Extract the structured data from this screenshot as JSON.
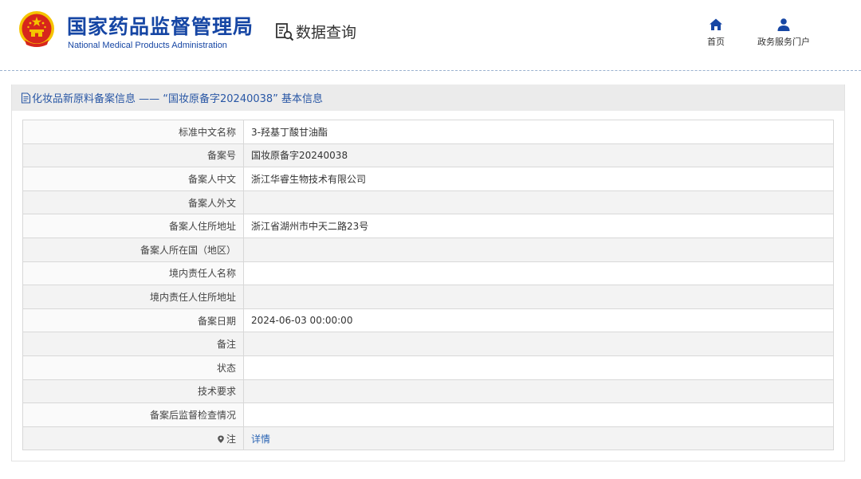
{
  "header": {
    "title_cn": "国家药品监督管理局",
    "title_en": "National Medical Products Administration",
    "query_label": "数据查询",
    "nav": {
      "home": "首页",
      "portal": "政务服务门户"
    }
  },
  "panel": {
    "title": "化妆品新原料备案信息 —— “国妆原备字20240038” 基本信息"
  },
  "rows": [
    {
      "label": "标准中文名称",
      "value": "3-羟基丁酸甘油酯"
    },
    {
      "label": "备案号",
      "value": "国妆原备字20240038"
    },
    {
      "label": "备案人中文",
      "value": "浙江华睿生物技术有限公司"
    },
    {
      "label": "备案人外文",
      "value": ""
    },
    {
      "label": "备案人住所地址",
      "value": "浙江省湖州市中天二路23号"
    },
    {
      "label": "备案人所在国（地区）",
      "value": ""
    },
    {
      "label": "境内责任人名称",
      "value": ""
    },
    {
      "label": "境内责任人住所地址",
      "value": ""
    },
    {
      "label": "备案日期",
      "value": "2024-06-03 00:00:00"
    },
    {
      "label": "备注",
      "value": ""
    },
    {
      "label": "状态",
      "value": ""
    },
    {
      "label": "技术要求",
      "value": ""
    },
    {
      "label": "备案后监督检查情况",
      "value": ""
    },
    {
      "label": "注",
      "value": "详情"
    }
  ],
  "colors": {
    "brand": "#1646a4",
    "link": "#2b65b4",
    "emblem_red": "#d7261c",
    "emblem_gold": "#f5c400"
  }
}
